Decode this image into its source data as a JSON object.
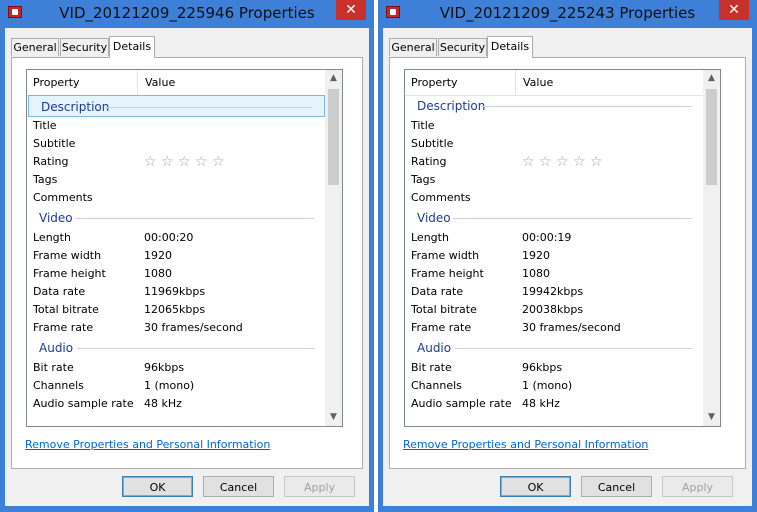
{
  "windows": [
    {
      "title": "VID_20121209_225946 Properties",
      "close": "✕",
      "tabs": {
        "general": "General",
        "security": "Security",
        "details": "Details"
      },
      "header": {
        "property": "Property",
        "value": "Value"
      },
      "sections": {
        "description": {
          "label": "Description",
          "title": "Title",
          "subtitle": "Subtitle",
          "rating": "Rating",
          "tags": "Tags",
          "comments": "Comments"
        },
        "video": {
          "label": "Video",
          "length": {
            "label": "Length",
            "value": "00:00:20"
          },
          "frame_width": {
            "label": "Frame width",
            "value": "1920"
          },
          "frame_height": {
            "label": "Frame height",
            "value": "1080"
          },
          "data_rate": {
            "label": "Data rate",
            "value": "11969kbps"
          },
          "total_bitrate": {
            "label": "Total bitrate",
            "value": "12065kbps"
          },
          "frame_rate": {
            "label": "Frame rate",
            "value": "30 frames/second"
          }
        },
        "audio": {
          "label": "Audio",
          "bit_rate": {
            "label": "Bit rate",
            "value": "96kbps"
          },
          "channels": {
            "label": "Channels",
            "value": "1 (mono)"
          },
          "sample_rate": {
            "label": "Audio sample rate",
            "value": "48 kHz"
          }
        }
      },
      "link": "Remove Properties and Personal Information",
      "buttons": {
        "ok": "OK",
        "cancel": "Cancel",
        "apply": "Apply"
      }
    },
    {
      "title": "VID_20121209_225243 Properties",
      "close": "✕",
      "tabs": {
        "general": "General",
        "security": "Security",
        "details": "Details"
      },
      "header": {
        "property": "Property",
        "value": "Value"
      },
      "sections": {
        "description": {
          "label": "Description",
          "title": "Title",
          "subtitle": "Subtitle",
          "rating": "Rating",
          "tags": "Tags",
          "comments": "Comments"
        },
        "video": {
          "label": "Video",
          "length": {
            "label": "Length",
            "value": "00:00:19"
          },
          "frame_width": {
            "label": "Frame width",
            "value": "1920"
          },
          "frame_height": {
            "label": "Frame height",
            "value": "1080"
          },
          "data_rate": {
            "label": "Data rate",
            "value": "19942kbps"
          },
          "total_bitrate": {
            "label": "Total bitrate",
            "value": "20038kbps"
          },
          "frame_rate": {
            "label": "Frame rate",
            "value": "30 frames/second"
          }
        },
        "audio": {
          "label": "Audio",
          "bit_rate": {
            "label": "Bit rate",
            "value": "96kbps"
          },
          "channels": {
            "label": "Channels",
            "value": "1 (mono)"
          },
          "sample_rate": {
            "label": "Audio sample rate",
            "value": "48 kHz"
          }
        }
      },
      "link": "Remove Properties and Personal Information",
      "buttons": {
        "ok": "OK",
        "cancel": "Cancel",
        "apply": "Apply"
      }
    }
  ],
  "icons": {
    "star": "☆",
    "scroll_up": "▲",
    "scroll_down": "▼"
  },
  "colors": {
    "title_bar": "#3e7fd8",
    "close": "#c7312b",
    "link": "#0066cc",
    "group_header": "#1e3c8c",
    "selection": "#e5f3fb"
  }
}
